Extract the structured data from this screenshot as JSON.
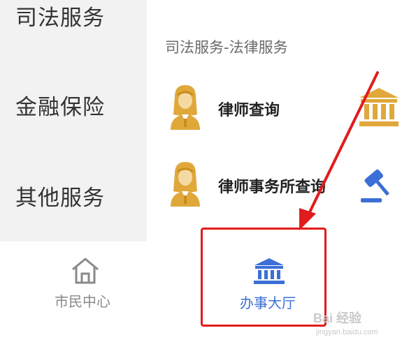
{
  "sidebar": {
    "items": [
      {
        "label": "司法服务"
      },
      {
        "label": "金融保险"
      },
      {
        "label": "其他服务"
      }
    ]
  },
  "main": {
    "section_title": "司法服务-法律服务",
    "rows": [
      {
        "label": "律师查询",
        "avatar_icon": "lawyer-avatar-icon",
        "right_icon": "courthouse-icon"
      },
      {
        "label": "律师事务所查询",
        "avatar_icon": "lawyer-avatar-icon",
        "right_icon": "gavel-icon"
      }
    ]
  },
  "tabbar": {
    "tabs": [
      {
        "label": "市民中心",
        "icon": "home-icon",
        "active": false
      },
      {
        "label": "办事大厅",
        "icon": "courthouse-icon",
        "active": true
      }
    ]
  },
  "colors": {
    "accent": "#3b6fd6",
    "gold": "#e0a83a",
    "annotation_red": "#e11c1c"
  },
  "watermark": {
    "text": "Bai 经验",
    "sub": "jingyan.baidu.com"
  }
}
